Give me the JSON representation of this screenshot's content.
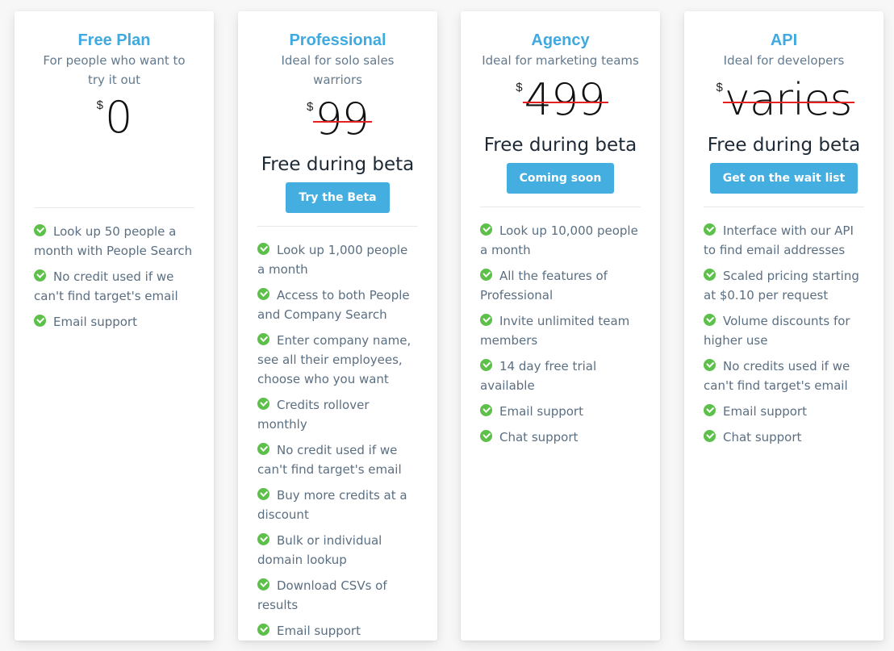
{
  "colors": {
    "accent": "#3fa9e0",
    "button": "#45aee0",
    "check": "#5cc04a",
    "strikethrough": "#e52020",
    "feature_text": "#5b6f82"
  },
  "plans": [
    {
      "name": "Free Plan",
      "description": "For people who want to try it out",
      "currency": "$",
      "price": "0",
      "struck": false,
      "features": [
        "Look up 50 people a month with People Search",
        "No credit used if we can't find target's email",
        "Email support"
      ]
    },
    {
      "name": "Professional",
      "description": "Ideal for solo sales warriors",
      "currency": "$",
      "price": "99",
      "struck": true,
      "beta_label": "Free during beta",
      "button_label": "Try the Beta",
      "features": [
        "Look up 1,000 people a month",
        "Access to both People and Company Search",
        "Enter company name, see all their employees, choose who you want",
        "Credits rollover monthly",
        "No credit used if we can't find target's email",
        "Buy more credits at a discount",
        "Bulk or individual domain lookup",
        "Download CSVs of results",
        "Email support"
      ]
    },
    {
      "name": "Agency",
      "description": "Ideal for marketing teams",
      "currency": "$",
      "price": "499",
      "struck": true,
      "beta_label": "Free during beta",
      "button_label": "Coming soon",
      "features": [
        "Look up 10,000 people a month",
        "All the features of Professional",
        "Invite unlimited team members",
        "14 day free trial available",
        "Email support",
        "Chat support"
      ]
    },
    {
      "name": "API",
      "description": "Ideal for developers",
      "currency": "$",
      "price": "varies",
      "struck": true,
      "beta_label": "Free during beta",
      "button_label": "Get on the wait list",
      "features": [
        "Interface with our API to find email addresses",
        "Scaled pricing starting at $0.10 per request",
        "Volume discounts for higher use",
        "No credits used if we can't find target's email",
        "Email support",
        "Chat support"
      ]
    }
  ]
}
